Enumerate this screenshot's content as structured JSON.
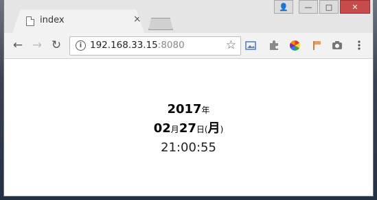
{
  "tab": {
    "title": "index",
    "close": "×"
  },
  "window_controls": {
    "user": "👤",
    "minimize": "—",
    "maximize": "□",
    "close": "✕"
  },
  "nav": {
    "back": "←",
    "forward": "→",
    "reload": "↻"
  },
  "address_bar": {
    "host": "192.168.33.15",
    "port": ":8080",
    "info": "i",
    "bookmark": "☆"
  },
  "extensions": [
    "folder-image-icon",
    "puzzle-icon",
    "pinwheel-icon",
    "flag-icon",
    "camera-icon",
    "menu-icon"
  ],
  "clock": {
    "year": "2017",
    "year_unit": "年",
    "month": "02",
    "month_unit": "月",
    "day": "27",
    "day_unit": "日",
    "paren_open": "(",
    "weekday": "月",
    "paren_close": ")",
    "time": "21:00:55"
  }
}
